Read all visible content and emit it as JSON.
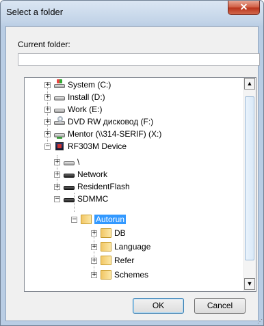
{
  "window": {
    "title": "Select a folder",
    "close_glyph": "✕"
  },
  "current_folder": {
    "label": "Current folder:",
    "value": ""
  },
  "tree": {
    "nodes": [
      {
        "label": "System (C:)",
        "expander": "+",
        "icon": "windows-drive-icon"
      },
      {
        "label": "Install (D:)",
        "expander": "+",
        "icon": "drive-icon"
      },
      {
        "label": "Work (E:)",
        "expander": "+",
        "icon": "drive-icon"
      },
      {
        "label": "DVD RW дисковод (F:)",
        "expander": "+",
        "icon": "dvd-drive-icon"
      },
      {
        "label": "Mentor (\\\\314-SERIF) (X:)",
        "expander": "+",
        "icon": "network-drive-icon"
      },
      {
        "label": "RF303M Device",
        "expander": "−",
        "icon": "device-icon"
      },
      {
        "label": "\\",
        "expander": "+",
        "icon": "drive-icon"
      },
      {
        "label": "Network",
        "expander": "+",
        "icon": "drive-dark-icon"
      },
      {
        "label": "ResidentFlash",
        "expander": "+",
        "icon": "drive-dark-icon"
      },
      {
        "label": "SDMMC",
        "expander": "−",
        "icon": "drive-dark-icon"
      },
      {
        "label": "Autorun",
        "expander": "−",
        "icon": "folder-icon",
        "selected": true
      },
      {
        "label": "DB",
        "expander": "+",
        "icon": "folder-icon"
      },
      {
        "label": "Language",
        "expander": "+",
        "icon": "folder-icon"
      },
      {
        "label": "Refer",
        "expander": "+",
        "icon": "folder-icon"
      },
      {
        "label": "Schemes",
        "expander": "+",
        "icon": "folder-icon"
      }
    ],
    "scroll_up": "▲",
    "scroll_down": "▼"
  },
  "buttons": {
    "ok": "OK",
    "cancel": "Cancel"
  },
  "colors": {
    "selection": "#3399ff",
    "close": "#c9452b"
  }
}
